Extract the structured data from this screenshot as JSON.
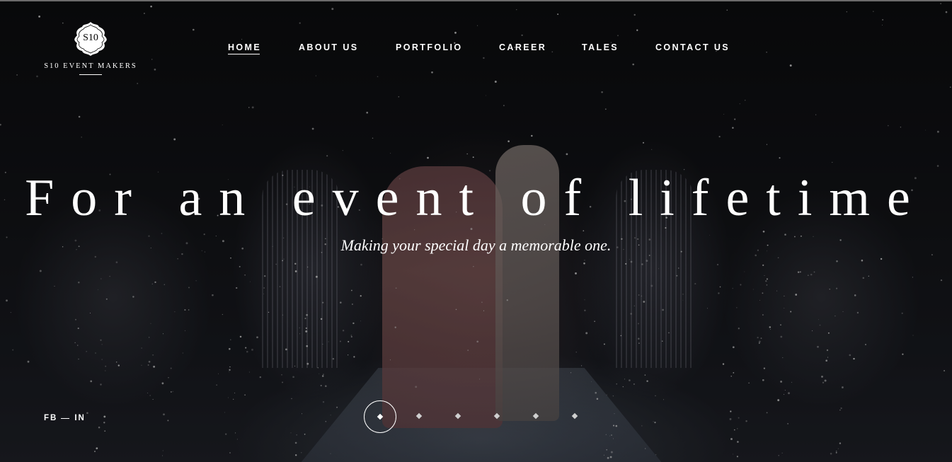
{
  "brand": {
    "mark": "S10",
    "name": "S10 EVENT MAKERS"
  },
  "nav": {
    "items": [
      {
        "label": "HOME",
        "active": true
      },
      {
        "label": "ABOUT US",
        "active": false
      },
      {
        "label": "PORTFOLIO",
        "active": false
      },
      {
        "label": "CAREER",
        "active": false
      },
      {
        "label": "TALES",
        "active": false
      },
      {
        "label": "CONTACT US",
        "active": false
      }
    ]
  },
  "hero": {
    "headline": "For an event of lifetime",
    "subheadline": "Making your special day a memorable one."
  },
  "social": {
    "fb": "FB",
    "in": "IN"
  },
  "slider": {
    "slide_count": 6,
    "active_slide": 1
  },
  "colors": {
    "text": "#ffffff",
    "background": "#0d0e10"
  }
}
